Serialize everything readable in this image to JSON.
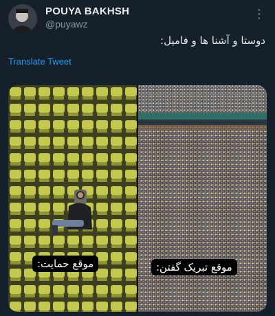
{
  "user": {
    "display_name": "POUYA BAKHSH",
    "handle": "@puyawz"
  },
  "tweet": {
    "text": "دوستا و آشنا ها و فامیل:",
    "translate_label": "Translate Tweet"
  },
  "media": {
    "left_caption": "موقع حمایت:",
    "right_caption": "موقع تبریک گفتن:"
  },
  "icons": {
    "more": "more-vertical-icon",
    "avatar": "user-avatar"
  },
  "colors": {
    "background": "#15202b",
    "link": "#1d9bf0",
    "secondary_text": "#8b98a5",
    "seat": "#c2c64a"
  }
}
